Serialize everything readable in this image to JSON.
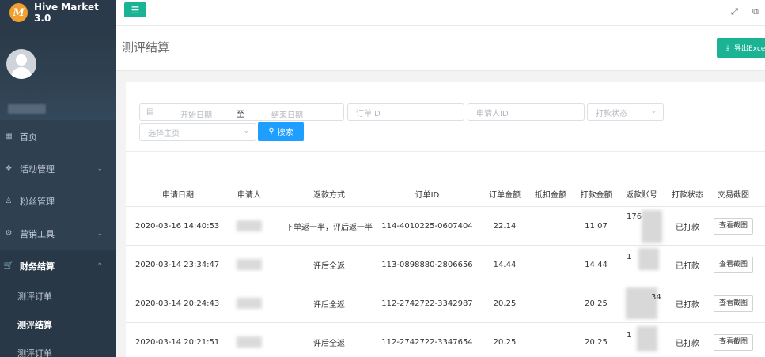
{
  "app": {
    "logo_letter": "M",
    "title": "Hive Market 3.0"
  },
  "sidebar": {
    "items": [
      {
        "label": "首页",
        "icon": "grid-icon",
        "chevron": false
      },
      {
        "label": "活动管理",
        "icon": "cubes-icon",
        "chevron": true
      },
      {
        "label": "粉丝管理",
        "icon": "user-icon",
        "chevron": false
      },
      {
        "label": "营销工具",
        "icon": "gears-icon",
        "chevron": true
      },
      {
        "label": "财务结算",
        "icon": "cart-icon",
        "chevron": true,
        "active": true
      }
    ],
    "sub_items": [
      {
        "label": "测评订单"
      },
      {
        "label": "测评结算"
      },
      {
        "label": "测评订单"
      }
    ]
  },
  "header": {
    "page_title": "测评结算",
    "export_label": "导出Excel"
  },
  "filters": {
    "date_start_placeholder": "开始日期",
    "date_separator": "至",
    "date_end_placeholder": "结束日期",
    "order_id_placeholder": "订单ID",
    "applicant_id_placeholder": "申请人ID",
    "pay_status_placeholder": "打款状态",
    "shop_placeholder": "选择主页",
    "search_label": "搜索"
  },
  "table": {
    "columns": [
      "申请日期",
      "申请人",
      "返款方式",
      "订单ID",
      "订单金额",
      "抵扣金额",
      "打款金额",
      "返款账号",
      "打款状态",
      "交易截图"
    ],
    "rows": [
      {
        "date": "2020-03-16 14:40:53",
        "method": "下单返一半，评后返一半",
        "order_id": "114-4010225-0607404",
        "order_amount": "22.14",
        "deduct": "",
        "pay_amount": "11.07",
        "account": "176",
        "status": "已打款",
        "action": "查看截图"
      },
      {
        "date": "2020-03-14 23:34:47",
        "method": "评后全返",
        "order_id": "113-0898880-2806656",
        "order_amount": "14.44",
        "deduct": "",
        "pay_amount": "14.44",
        "account": "1",
        "status": "已打款",
        "action": "查看截图"
      },
      {
        "date": "2020-03-14 20:24:43",
        "method": "评后全返",
        "order_id": "112-2742722-3342987",
        "order_amount": "20.25",
        "deduct": "",
        "pay_amount": "20.25",
        "account": "34",
        "status": "已打款",
        "action": "查看截图"
      },
      {
        "date": "2020-03-14 20:21:51",
        "method": "评后全返",
        "order_id": "112-2742722-3347654",
        "order_amount": "20.25",
        "deduct": "",
        "pay_amount": "20.25",
        "account": "1",
        "status": "已打款",
        "action": "查看截图"
      }
    ]
  },
  "colors": {
    "accent": "#1ab394",
    "primary": "#1e9fff",
    "sidebar_bg": "#2f4050"
  }
}
